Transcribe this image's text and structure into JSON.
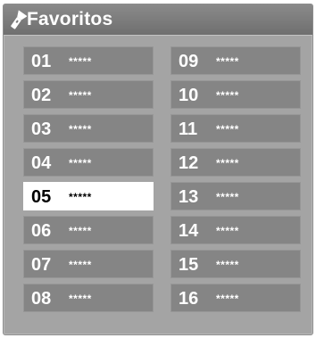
{
  "header": {
    "title": "Favoritos",
    "icon": "flashlight-icon"
  },
  "left_column": [
    {
      "number": "01",
      "name": "*****"
    },
    {
      "number": "02",
      "name": "*****"
    },
    {
      "number": "03",
      "name": "*****"
    },
    {
      "number": "04",
      "name": "*****"
    },
    {
      "number": "05",
      "name": "*****",
      "selected": true
    },
    {
      "number": "06",
      "name": "*****"
    },
    {
      "number": "07",
      "name": "*****"
    },
    {
      "number": "08",
      "name": "*****"
    }
  ],
  "right_column": [
    {
      "number": "09",
      "name": "*****"
    },
    {
      "number": "10",
      "name": "*****"
    },
    {
      "number": "11",
      "name": "*****"
    },
    {
      "number": "12",
      "name": "*****"
    },
    {
      "number": "13",
      "name": "*****"
    },
    {
      "number": "14",
      "name": "*****"
    },
    {
      "number": "15",
      "name": "*****"
    },
    {
      "number": "16",
      "name": "*****"
    }
  ],
  "colors": {
    "panel": "#a4a4a4",
    "item": "#858585",
    "selected": "#ffffff",
    "header": "#7c7c7c"
  }
}
